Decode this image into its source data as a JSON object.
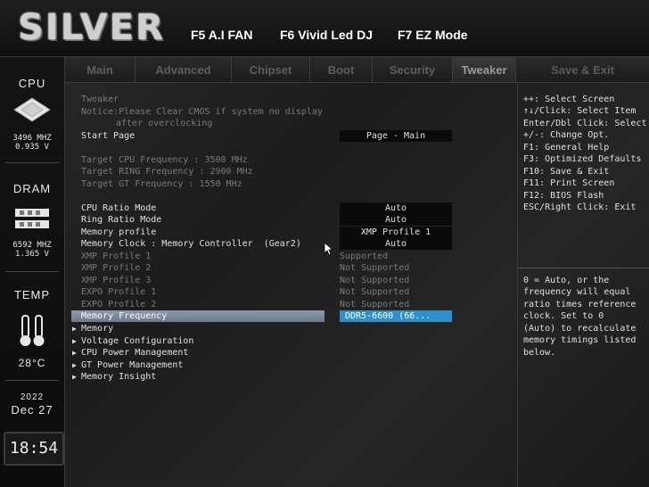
{
  "brand": "SILVER",
  "hotkeys": [
    "F5 A.I FAN",
    "F6 Vivid Led DJ",
    "F7 EZ Mode"
  ],
  "tabs": [
    "Main",
    "Advanced",
    "Chipset",
    "Boot",
    "Security",
    "Tweaker",
    "Save & Exit"
  ],
  "active_tab": "Tweaker",
  "sidebar": {
    "cpu": {
      "title": "CPU",
      "freq": "3496 MHZ",
      "volt": "0.935 V"
    },
    "dram": {
      "title": "DRAM",
      "freq": "6592 MHZ",
      "volt": "1.365 V"
    },
    "temp": {
      "title": "TEMP",
      "value": "28°C"
    },
    "date": {
      "year": "2022",
      "monthday": "Dec 27"
    },
    "clock": "18:54"
  },
  "main": {
    "section": "Tweaker",
    "notice1": "Notice:Please Clear CMOS if system no display",
    "notice2": "after overclocking",
    "start_page_label": "Start Page",
    "start_page_value": "Page - Main",
    "target_cpu": "Target CPU Frequency : 3500 MHz",
    "target_ring": "Target RING Frequency : 2900 MHz",
    "target_gt": "Target GT Frequency : 1550 MHz",
    "settings": [
      {
        "label": "CPU Ratio Mode",
        "value": "Auto"
      },
      {
        "label": "Ring Ratio Mode",
        "value": "Auto"
      },
      {
        "label": "Memory profile",
        "value": "XMP Profile 1"
      },
      {
        "label": "Memory Clock : Memory Controller  (Gear2)",
        "value": "Auto"
      }
    ],
    "profiles": [
      {
        "label": "XMP Profile 1",
        "value": "Supported"
      },
      {
        "label": "XMP Profile 2",
        "value": "Not Supported"
      },
      {
        "label": "XMP Profile 3",
        "value": "Not Supported"
      },
      {
        "label": "EXPO Profile 1",
        "value": "Not Supported"
      },
      {
        "label": "EXPO Profile 2",
        "value": "Not Supported"
      }
    ],
    "selected": {
      "label": "Memory Frequency",
      "value": "DDR5-6600    (66..."
    },
    "submenus": [
      "Memory",
      "Voltage Configuration",
      "CPU Power Management",
      "GT Power Management",
      "Memory Insight"
    ]
  },
  "help_keys": [
    "++: Select Screen",
    "↑↓/Click: Select Item",
    "Enter/Dbl Click: Select",
    "+/-: Change Opt.",
    "F1: General Help",
    "F3: Optimized Defaults",
    "F10: Save & Exit",
    "F11: Print Screen",
    "F12: BIOS Flash",
    "ESC/Right Click: Exit"
  ],
  "help_text": [
    "0 = Auto, or the",
    "frequency will equal",
    "ratio times reference",
    "clock. Set to 0",
    "(Auto) to recalculate",
    "memory timings listed",
    "below."
  ]
}
